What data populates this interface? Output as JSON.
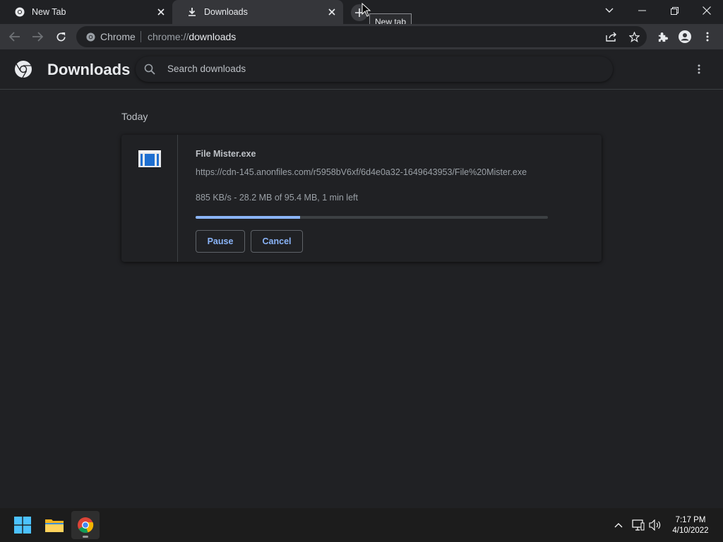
{
  "tabs": [
    {
      "title": "New Tab",
      "icon": "chrome-icon",
      "active": false
    },
    {
      "title": "Downloads",
      "icon": "download-icon",
      "active": true
    }
  ],
  "new_tab_tooltip": "New tab",
  "omnibox": {
    "site_label": "Chrome",
    "url_scheme": "chrome://",
    "url_path": "downloads"
  },
  "header": {
    "title": "Downloads",
    "search_placeholder": "Search downloads"
  },
  "downloads": {
    "date_group": "Today",
    "item": {
      "file_name": "File Mister.exe",
      "url": "https://cdn-145.anonfiles.com/r5958bV6xf/6d4e0a32-1649643953/File%20Mister.exe",
      "status": "885 KB/s - 28.2 MB of 95.4 MB, 1 min left",
      "progress_fraction": 0.2956,
      "pause_label": "Pause",
      "cancel_label": "Cancel"
    }
  },
  "taskbar": {
    "apps": [
      "start-icon",
      "file-explorer-icon",
      "chrome-icon"
    ],
    "clock_time": "7:17 PM",
    "clock_date": "4/10/2022"
  },
  "colors": {
    "accent": "#8ab4f8",
    "background": "#202124",
    "toolbar": "#35363a"
  }
}
